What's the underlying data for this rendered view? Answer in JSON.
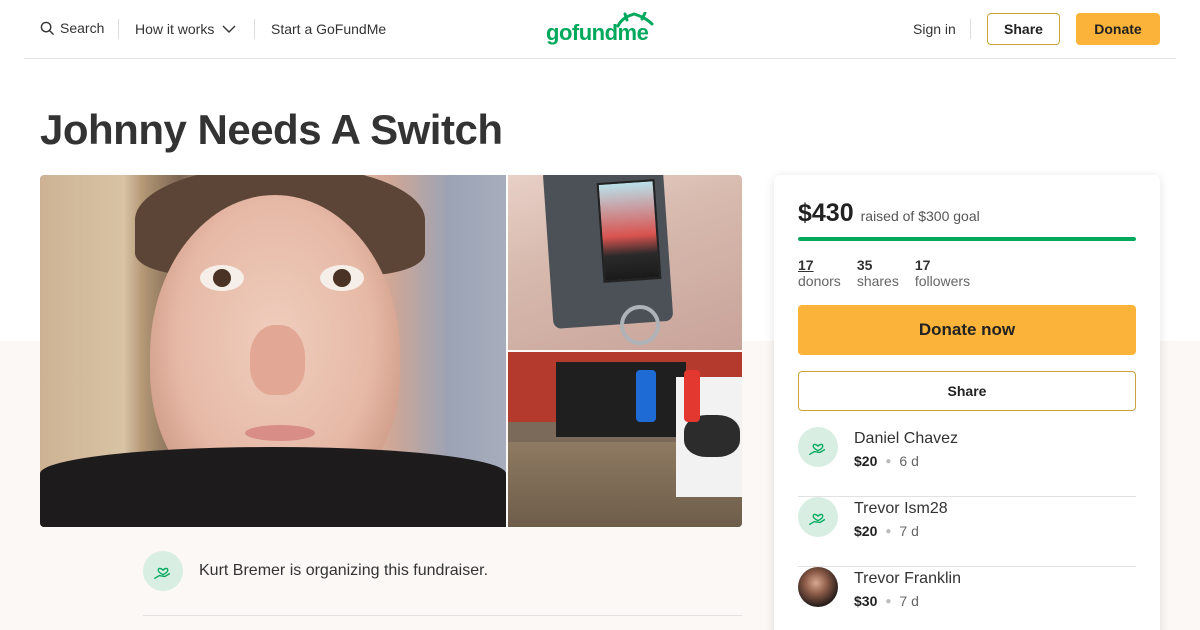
{
  "nav": {
    "search_label": "Search",
    "how_label": "How it works",
    "start_label": "Start a GoFundMe",
    "logo_text": "gofundme",
    "signin_label": "Sign in",
    "share_label": "Share",
    "donate_label": "Donate"
  },
  "campaign": {
    "title": "Johnny Needs A Switch",
    "organizer_text": "Kurt Bremer is organizing this fundraiser."
  },
  "sidebar": {
    "raised_amount": "$430",
    "raised_goal": "raised of $300 goal",
    "progress_fraction": 1.0,
    "stats": [
      {
        "value": "17",
        "label": "donors"
      },
      {
        "value": "35",
        "label": "shares"
      },
      {
        "value": "17",
        "label": "followers"
      }
    ],
    "donate_now_label": "Donate now",
    "share_label": "Share",
    "donations": [
      {
        "name": "Daniel Chavez",
        "amount": "$20",
        "time": "6 d",
        "avatar": "heart-hand-icon"
      },
      {
        "name": "Trevor Ism28",
        "amount": "$20",
        "time": "7 d",
        "avatar": "heart-hand-icon"
      },
      {
        "name": "Trevor Franklin",
        "amount": "$30",
        "time": "7 d",
        "avatar": "photo"
      }
    ]
  },
  "colors": {
    "brand_green": "#02a95c",
    "donate_yellow": "#fbb339",
    "share_border": "#c9a23b"
  }
}
